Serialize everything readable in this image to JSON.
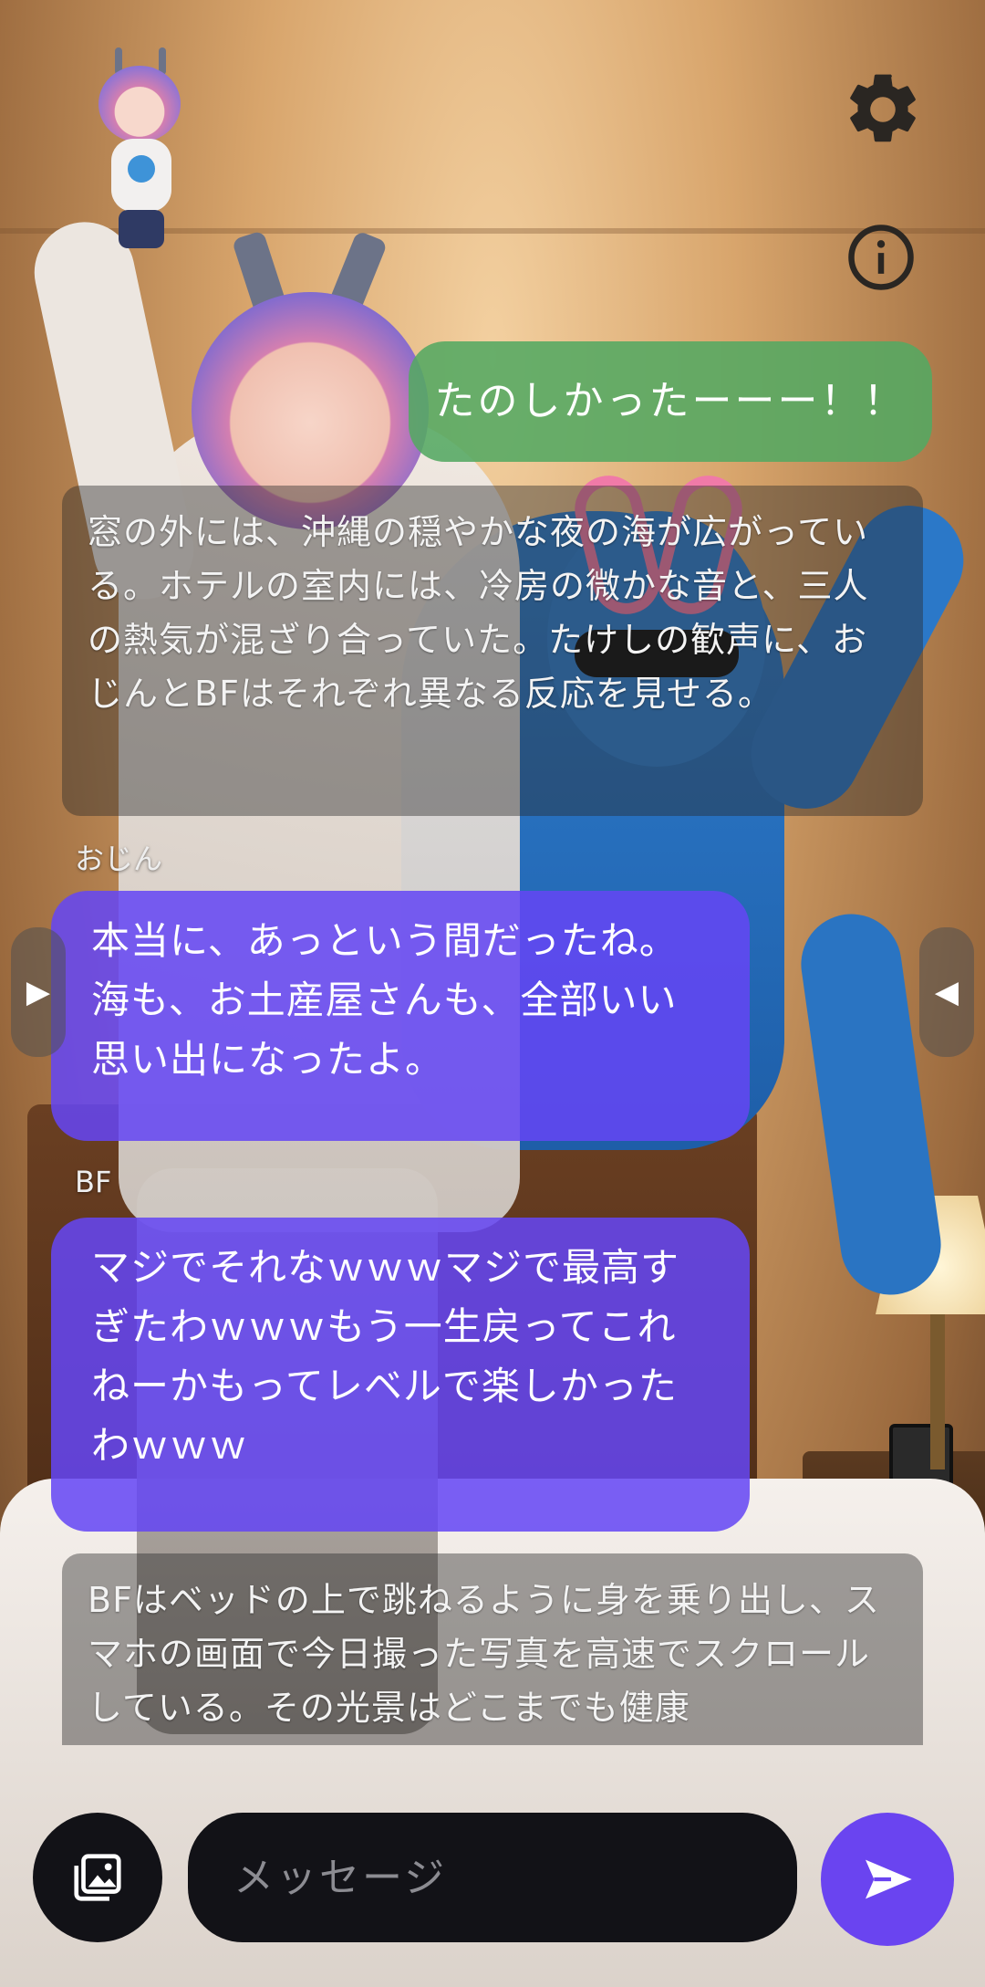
{
  "header": {
    "settings_icon": "gear-icon",
    "info_icon": "info-icon"
  },
  "messages": {
    "user": "たのしかったーーー！！",
    "narration_1": "窓の外には、沖縄の穏やかな夜の海が広がっている。ホテルの室内には、冷房の微かな音と、三人の熱気が混ざり合っていた。たけしの歓声に、おじんとBFはそれぞれ異なる反応を見せる。",
    "ojin_name": "おじん",
    "ojin_text": "本当に、あっという間だったね。海も、お土産屋さんも、全部いい思い出になったよ。",
    "bf_name": "BF",
    "bf_text": "マジでそれなｗｗｗマジで最高すぎたわｗｗｗもう一生戻ってこれねーかもってレベルで楽しかったわｗｗｗ",
    "narration_2": "BFはベッドの上で跳ねるように身を乗り出し、スマホの画面で今日撮った写真を高速でスクロールしている。その光景はどこまでも健康"
  },
  "nav": {
    "left_arrow": "▶",
    "right_arrow": "◀"
  },
  "composer": {
    "placeholder": "メッセージ",
    "gallery_icon": "image-gallery-icon",
    "send_icon": "send-icon"
  },
  "colors": {
    "user_bubble": "#54A862",
    "character_bubble": "#6446F5",
    "send_button": "#6A44F0",
    "input_background": "#121217"
  }
}
